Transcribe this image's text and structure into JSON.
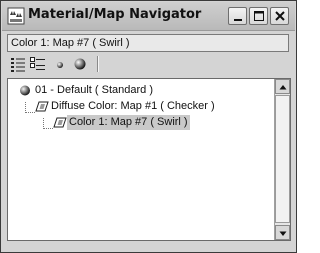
{
  "window": {
    "title": "Material/Map Navigator",
    "controls": [
      "minimize",
      "maximize",
      "close"
    ]
  },
  "path_field": {
    "value": "Color 1: Map #7  ( Swirl )"
  },
  "toolbar": {
    "buttons": [
      {
        "icon": "view-list-icon"
      },
      {
        "icon": "view-list-icons-icon"
      },
      {
        "icon": "view-small-icons-icon"
      },
      {
        "icon": "view-large-icons-icon"
      }
    ]
  },
  "tree": {
    "items": [
      {
        "label": "01 - Default  ( Standard )",
        "icon": "material-sphere-icon",
        "level": 0,
        "selected": false
      },
      {
        "label": "Diffuse Color: Map #1  ( Checker )",
        "icon": "map-parallelogram-icon",
        "level": 1,
        "selected": false
      },
      {
        "label": "Color 1: Map #7  ( Swirl )",
        "icon": "map-parallelogram-icon",
        "level": 2,
        "selected": true
      }
    ]
  },
  "scrollbar": {
    "position": 0
  }
}
